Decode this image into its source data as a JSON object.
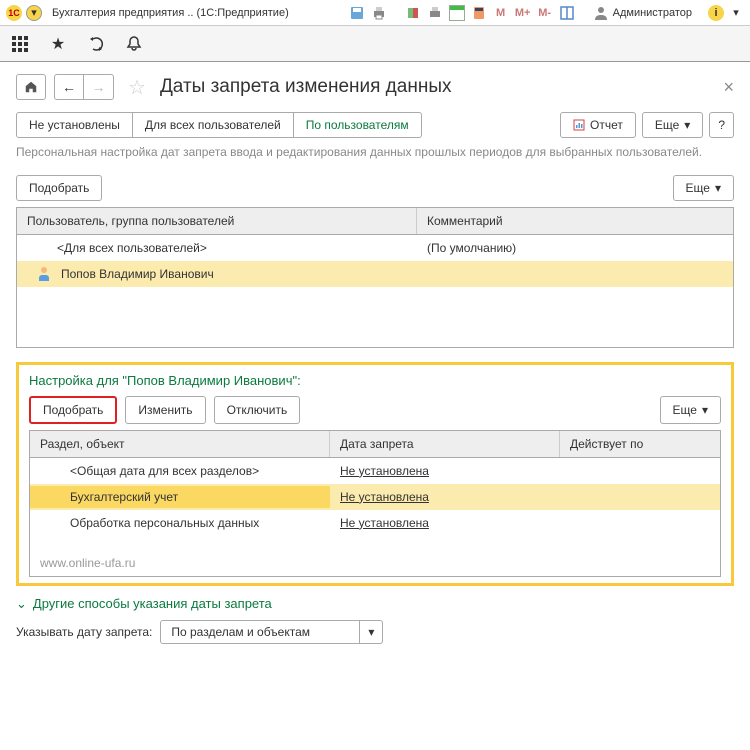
{
  "titlebar": {
    "app_title": "Бухгалтерия предприятия‎ ‎.. (1С:Предприятие)",
    "admin_label": "Администратор"
  },
  "mem_m": "M",
  "mem_mplus": "M+",
  "mem_mminus": "M-",
  "page": {
    "title": "Даты запрета изменения данных",
    "tabs": {
      "t1": "Не установлены",
      "t2": "Для всех пользователей",
      "t3": "По пользователям"
    },
    "report_btn": "Отчет",
    "more_btn": "Еще",
    "help_btn": "?",
    "description": "Персональная настройка дат запрета ввода и редактирования данных прошлых периодов для выбранных пользователей.",
    "select_btn": "Подобрать"
  },
  "grid1": {
    "col1": "Пользователь, группа пользователей",
    "col2": "Комментарий",
    "row1_user": "<Для всех пользователей>",
    "row1_comment": "(По умолчанию)",
    "row2_user": "Попов Владимир Иванович"
  },
  "section2": {
    "title": "Настройка для \"Попов Владимир Иванович\":",
    "select_btn": "Подобрать",
    "edit_btn": "Изменить",
    "disable_btn": "Отключить",
    "more_btn": "Еще",
    "col1": "Раздел, объект",
    "col2": "Дата запрета",
    "col3": "Действует по",
    "r1c1": "<Общая дата для всех разделов>",
    "r1c2": "Не установлена",
    "r2c1": "Бухгалтерский учет",
    "r2c2": "Не установлена",
    "r3c1": "Обработка персональных данных",
    "r3c2": "Не установлена",
    "watermark": "www.online-ufa.ru"
  },
  "expand": {
    "label": "Другие способы указания даты запрета"
  },
  "date_mode": {
    "label": "Указывать дату запрета:",
    "value": "По разделам и объектам"
  }
}
